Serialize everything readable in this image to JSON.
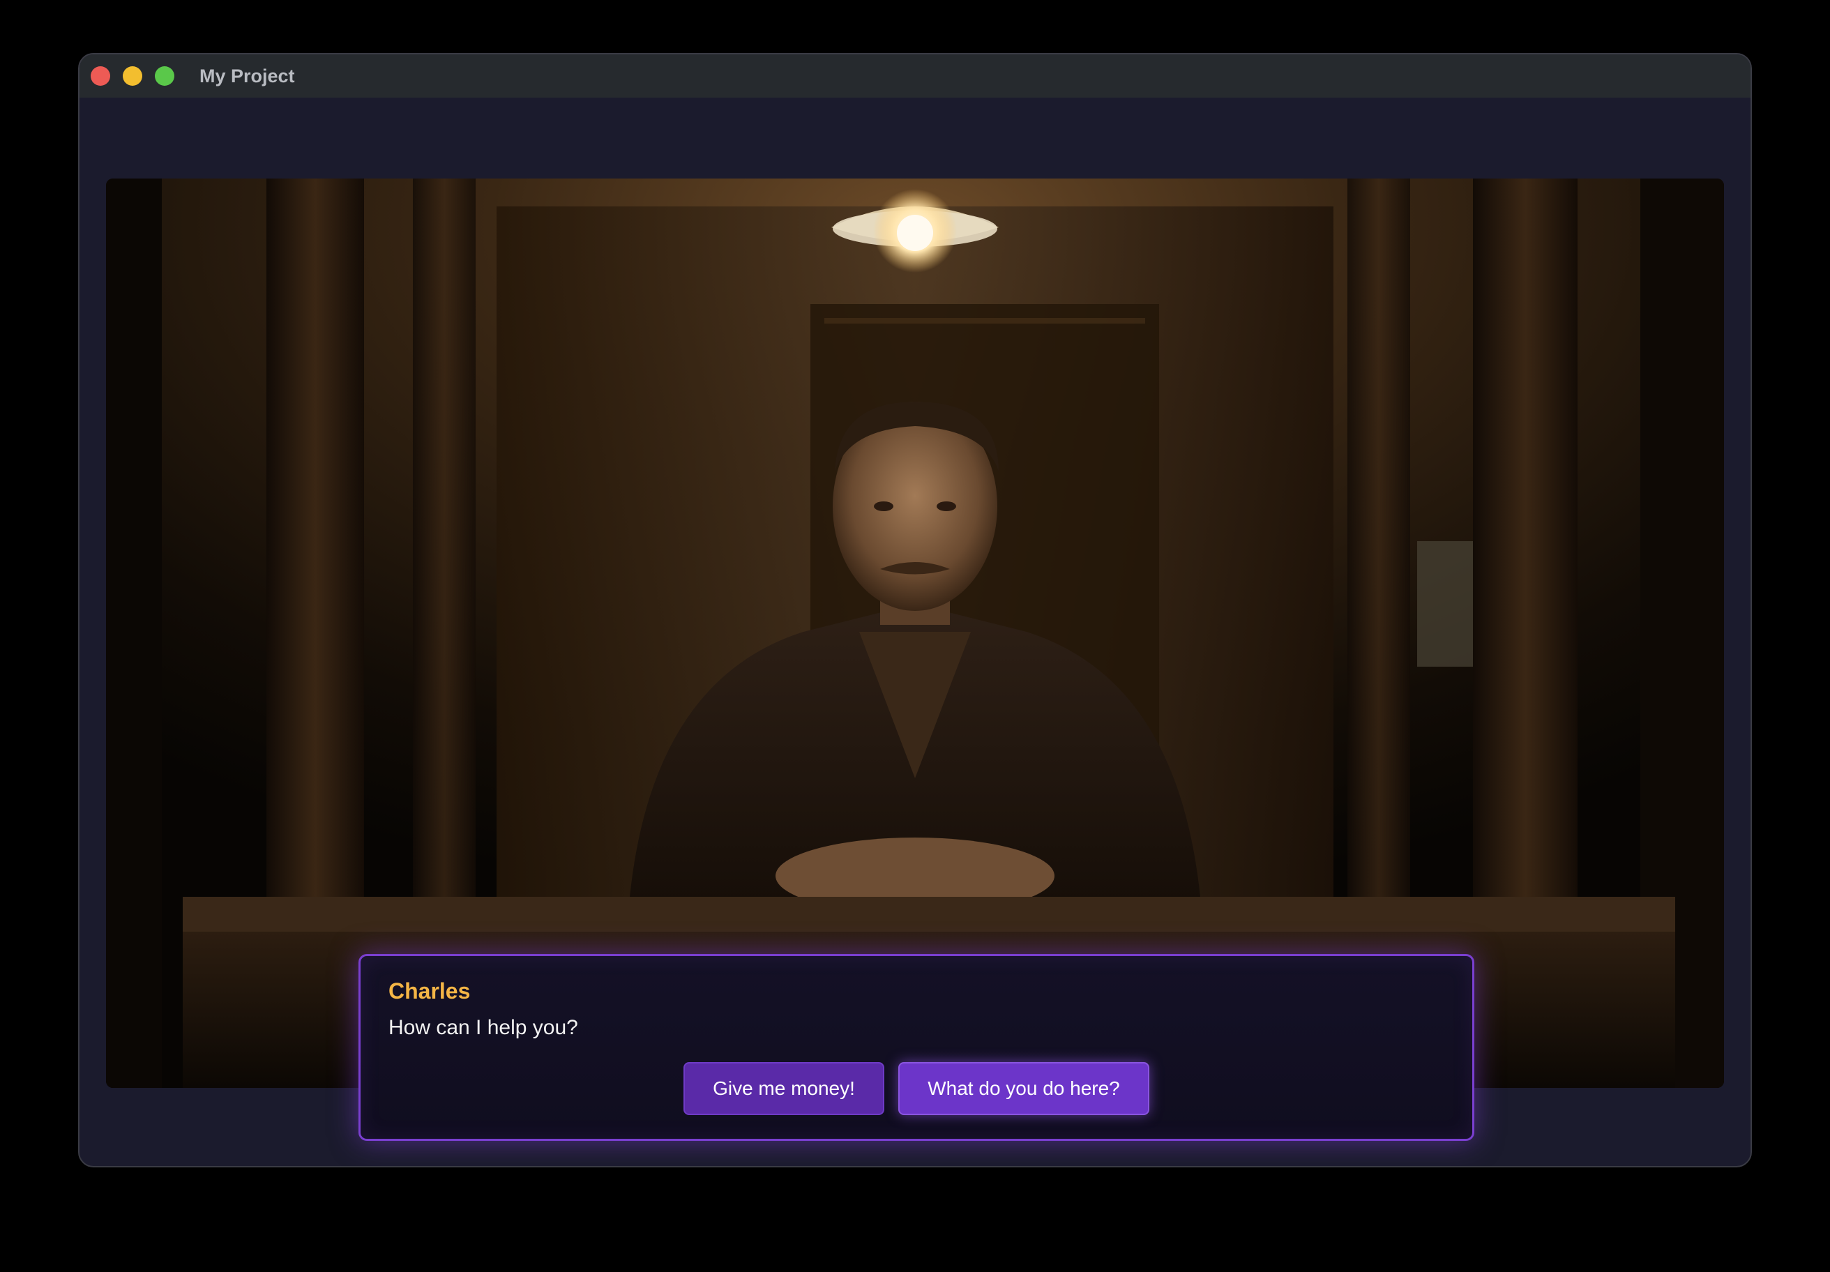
{
  "window": {
    "title": "My Project"
  },
  "scene": {
    "description_icon": "character-portrait"
  },
  "dialog": {
    "speaker": "Charles",
    "text": "How can I help you?",
    "choices": [
      {
        "label": "Give me money!"
      },
      {
        "label": "What do you do here?"
      }
    ]
  },
  "colors": {
    "speaker": "#f5b646",
    "dialog_border": "#7a3fd0",
    "button": "#5a2aa8",
    "button_hover": "#6c35c9"
  }
}
